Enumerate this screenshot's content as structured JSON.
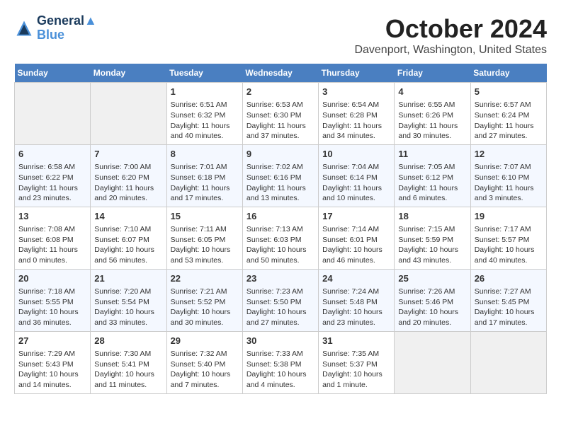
{
  "header": {
    "logo_line1": "General",
    "logo_line2": "Blue",
    "month": "October 2024",
    "location": "Davenport, Washington, United States"
  },
  "days_of_week": [
    "Sunday",
    "Monday",
    "Tuesday",
    "Wednesday",
    "Thursday",
    "Friday",
    "Saturday"
  ],
  "weeks": [
    [
      {
        "day": "",
        "empty": true
      },
      {
        "day": "",
        "empty": true
      },
      {
        "day": "1",
        "sunrise": "Sunrise: 6:51 AM",
        "sunset": "Sunset: 6:32 PM",
        "daylight": "Daylight: 11 hours and 40 minutes."
      },
      {
        "day": "2",
        "sunrise": "Sunrise: 6:53 AM",
        "sunset": "Sunset: 6:30 PM",
        "daylight": "Daylight: 11 hours and 37 minutes."
      },
      {
        "day": "3",
        "sunrise": "Sunrise: 6:54 AM",
        "sunset": "Sunset: 6:28 PM",
        "daylight": "Daylight: 11 hours and 34 minutes."
      },
      {
        "day": "4",
        "sunrise": "Sunrise: 6:55 AM",
        "sunset": "Sunset: 6:26 PM",
        "daylight": "Daylight: 11 hours and 30 minutes."
      },
      {
        "day": "5",
        "sunrise": "Sunrise: 6:57 AM",
        "sunset": "Sunset: 6:24 PM",
        "daylight": "Daylight: 11 hours and 27 minutes."
      }
    ],
    [
      {
        "day": "6",
        "sunrise": "Sunrise: 6:58 AM",
        "sunset": "Sunset: 6:22 PM",
        "daylight": "Daylight: 11 hours and 23 minutes."
      },
      {
        "day": "7",
        "sunrise": "Sunrise: 7:00 AM",
        "sunset": "Sunset: 6:20 PM",
        "daylight": "Daylight: 11 hours and 20 minutes."
      },
      {
        "day": "8",
        "sunrise": "Sunrise: 7:01 AM",
        "sunset": "Sunset: 6:18 PM",
        "daylight": "Daylight: 11 hours and 17 minutes."
      },
      {
        "day": "9",
        "sunrise": "Sunrise: 7:02 AM",
        "sunset": "Sunset: 6:16 PM",
        "daylight": "Daylight: 11 hours and 13 minutes."
      },
      {
        "day": "10",
        "sunrise": "Sunrise: 7:04 AM",
        "sunset": "Sunset: 6:14 PM",
        "daylight": "Daylight: 11 hours and 10 minutes."
      },
      {
        "day": "11",
        "sunrise": "Sunrise: 7:05 AM",
        "sunset": "Sunset: 6:12 PM",
        "daylight": "Daylight: 11 hours and 6 minutes."
      },
      {
        "day": "12",
        "sunrise": "Sunrise: 7:07 AM",
        "sunset": "Sunset: 6:10 PM",
        "daylight": "Daylight: 11 hours and 3 minutes."
      }
    ],
    [
      {
        "day": "13",
        "sunrise": "Sunrise: 7:08 AM",
        "sunset": "Sunset: 6:08 PM",
        "daylight": "Daylight: 11 hours and 0 minutes."
      },
      {
        "day": "14",
        "sunrise": "Sunrise: 7:10 AM",
        "sunset": "Sunset: 6:07 PM",
        "daylight": "Daylight: 10 hours and 56 minutes."
      },
      {
        "day": "15",
        "sunrise": "Sunrise: 7:11 AM",
        "sunset": "Sunset: 6:05 PM",
        "daylight": "Daylight: 10 hours and 53 minutes."
      },
      {
        "day": "16",
        "sunrise": "Sunrise: 7:13 AM",
        "sunset": "Sunset: 6:03 PM",
        "daylight": "Daylight: 10 hours and 50 minutes."
      },
      {
        "day": "17",
        "sunrise": "Sunrise: 7:14 AM",
        "sunset": "Sunset: 6:01 PM",
        "daylight": "Daylight: 10 hours and 46 minutes."
      },
      {
        "day": "18",
        "sunrise": "Sunrise: 7:15 AM",
        "sunset": "Sunset: 5:59 PM",
        "daylight": "Daylight: 10 hours and 43 minutes."
      },
      {
        "day": "19",
        "sunrise": "Sunrise: 7:17 AM",
        "sunset": "Sunset: 5:57 PM",
        "daylight": "Daylight: 10 hours and 40 minutes."
      }
    ],
    [
      {
        "day": "20",
        "sunrise": "Sunrise: 7:18 AM",
        "sunset": "Sunset: 5:55 PM",
        "daylight": "Daylight: 10 hours and 36 minutes."
      },
      {
        "day": "21",
        "sunrise": "Sunrise: 7:20 AM",
        "sunset": "Sunset: 5:54 PM",
        "daylight": "Daylight: 10 hours and 33 minutes."
      },
      {
        "day": "22",
        "sunrise": "Sunrise: 7:21 AM",
        "sunset": "Sunset: 5:52 PM",
        "daylight": "Daylight: 10 hours and 30 minutes."
      },
      {
        "day": "23",
        "sunrise": "Sunrise: 7:23 AM",
        "sunset": "Sunset: 5:50 PM",
        "daylight": "Daylight: 10 hours and 27 minutes."
      },
      {
        "day": "24",
        "sunrise": "Sunrise: 7:24 AM",
        "sunset": "Sunset: 5:48 PM",
        "daylight": "Daylight: 10 hours and 23 minutes."
      },
      {
        "day": "25",
        "sunrise": "Sunrise: 7:26 AM",
        "sunset": "Sunset: 5:46 PM",
        "daylight": "Daylight: 10 hours and 20 minutes."
      },
      {
        "day": "26",
        "sunrise": "Sunrise: 7:27 AM",
        "sunset": "Sunset: 5:45 PM",
        "daylight": "Daylight: 10 hours and 17 minutes."
      }
    ],
    [
      {
        "day": "27",
        "sunrise": "Sunrise: 7:29 AM",
        "sunset": "Sunset: 5:43 PM",
        "daylight": "Daylight: 10 hours and 14 minutes."
      },
      {
        "day": "28",
        "sunrise": "Sunrise: 7:30 AM",
        "sunset": "Sunset: 5:41 PM",
        "daylight": "Daylight: 10 hours and 11 minutes."
      },
      {
        "day": "29",
        "sunrise": "Sunrise: 7:32 AM",
        "sunset": "Sunset: 5:40 PM",
        "daylight": "Daylight: 10 hours and 7 minutes."
      },
      {
        "day": "30",
        "sunrise": "Sunrise: 7:33 AM",
        "sunset": "Sunset: 5:38 PM",
        "daylight": "Daylight: 10 hours and 4 minutes."
      },
      {
        "day": "31",
        "sunrise": "Sunrise: 7:35 AM",
        "sunset": "Sunset: 5:37 PM",
        "daylight": "Daylight: 10 hours and 1 minute."
      },
      {
        "day": "",
        "empty": true
      },
      {
        "day": "",
        "empty": true
      }
    ]
  ]
}
